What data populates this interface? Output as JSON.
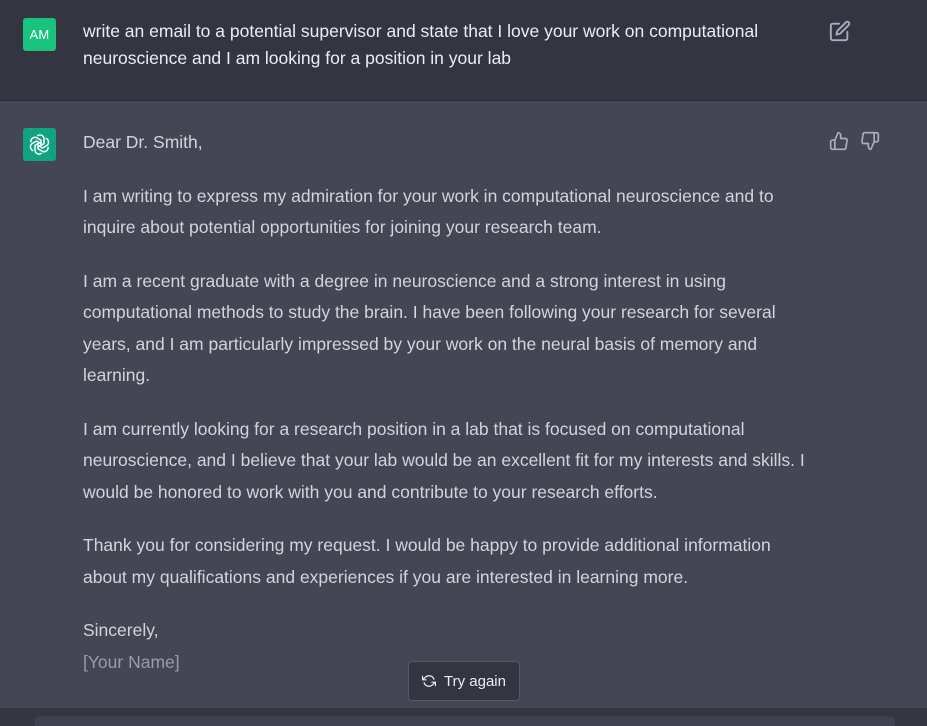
{
  "user_message": {
    "avatar_initials": "AM",
    "text": "write an email to a potential supervisor and state that I love your work on computational neuroscience and I am looking for a position in your lab",
    "edit_icon": "edit-icon"
  },
  "assistant_message": {
    "avatar_icon": "openai-logo-icon",
    "greeting": "Dear Dr. Smith,",
    "paragraphs": [
      "I am writing to express my admiration for your work in computational neuroscience and to inquire about potential opportunities for joining your research team.",
      "I am a recent graduate with a degree in neuroscience and a strong interest in using computational methods to study the brain. I have been following your research for several years, and I am particularly impressed by your work on the neural basis of memory and learning.",
      "I am currently looking for a research position in a lab that is focused on computational neuroscience, and I believe that your lab would be an excellent fit for my interests and skills. I would be honored to work with you and contribute to your research efforts.",
      "Thank you for considering my request. I would be happy to provide additional information about my qualifications and experiences if you are interested in learning more."
    ],
    "closing": "Sincerely,",
    "signature": "[Your Name]",
    "thumb_up_icon": "thumbs-up-icon",
    "thumb_down_icon": "thumbs-down-icon"
  },
  "controls": {
    "try_again_label": "Try again",
    "try_again_icon": "refresh-icon"
  },
  "colors": {
    "user_bg": "#343541",
    "assistant_bg": "#444654",
    "user_avatar": "#19c37d",
    "assistant_avatar": "#10a37f"
  }
}
